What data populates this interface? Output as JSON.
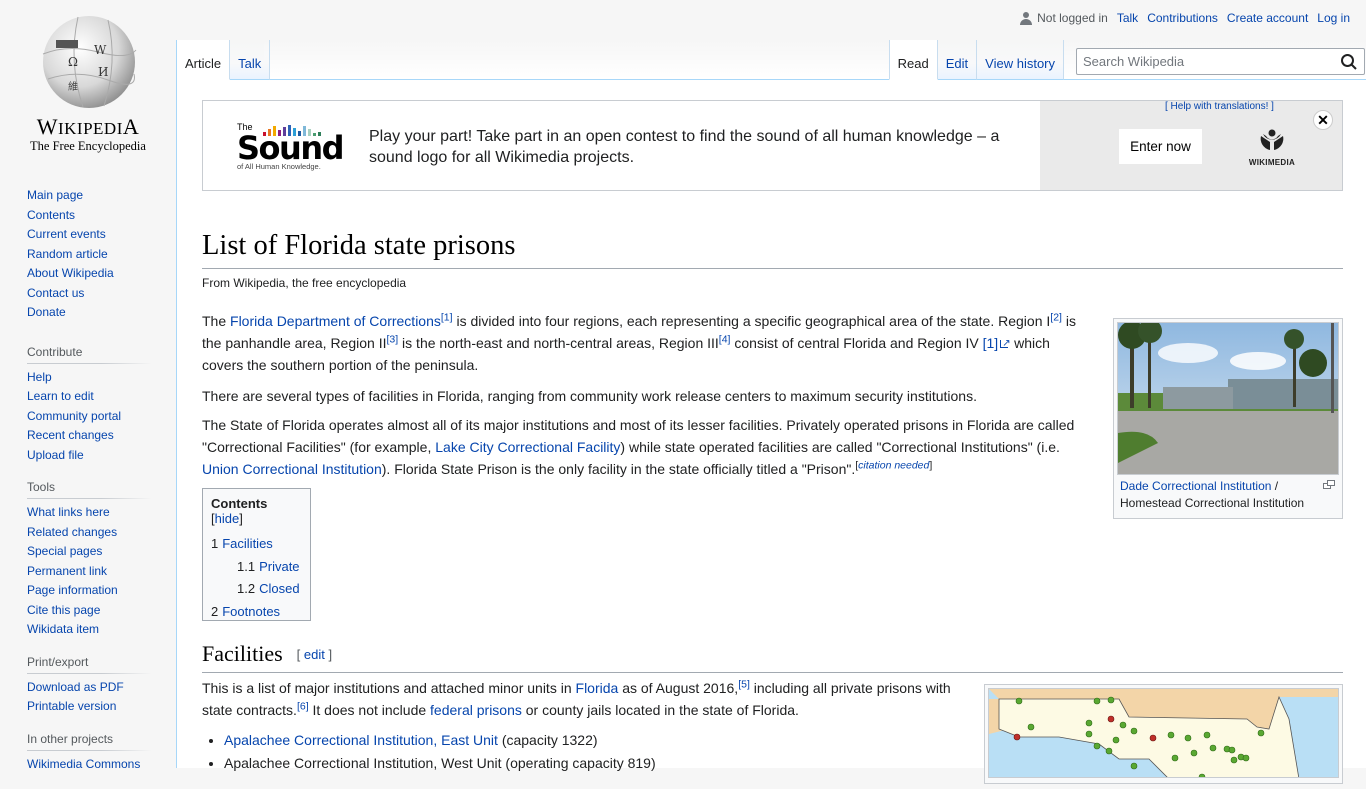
{
  "logo": {
    "wordmark_first": "W",
    "wordmark_rest": "IKIPEDI",
    "wordmark_last": "A",
    "tagline": "The Free Encyclopedia"
  },
  "personal": {
    "anon": "Not logged in",
    "links": [
      "Talk",
      "Contributions",
      "Create account",
      "Log in"
    ]
  },
  "tabs": {
    "left": [
      {
        "label": "Article",
        "selected": true
      },
      {
        "label": "Talk",
        "selected": false
      }
    ],
    "right": [
      {
        "label": "Read",
        "selected": true
      },
      {
        "label": "Edit",
        "selected": false
      },
      {
        "label": "View history",
        "selected": false
      }
    ]
  },
  "search": {
    "placeholder": "Search Wikipedia",
    "value": ""
  },
  "sidebar": {
    "navigation": [
      "Main page",
      "Contents",
      "Current events",
      "Random article",
      "About Wikipedia",
      "Contact us",
      "Donate"
    ],
    "contribute": {
      "title": "Contribute",
      "items": [
        "Help",
        "Learn to edit",
        "Community portal",
        "Recent changes",
        "Upload file"
      ]
    },
    "tools": {
      "title": "Tools",
      "items": [
        "What links here",
        "Related changes",
        "Special pages",
        "Permanent link",
        "Page information",
        "Cite this page",
        "Wikidata item"
      ]
    },
    "print": {
      "title": "Print/export",
      "items": [
        "Download as PDF",
        "Printable version"
      ]
    },
    "other": {
      "title": "In other projects",
      "items": [
        "Wikimedia Commons"
      ]
    }
  },
  "banner": {
    "logo_the": "The",
    "logo_sound": "Sound",
    "logo_sub": "of All Human Knowledge.",
    "message": "Play your part! Take part in an open contest to find the sound of all human knowledge – a sound logo for all Wikimedia projects.",
    "help": "[ Help with translations! ]",
    "button": "Enter now",
    "wikimedia": "WIKIMEDIA",
    "close": "✕",
    "bar_colors": [
      "#c8102e",
      "#e87722",
      "#f2a900",
      "#8c1d82",
      "#5e3f9b",
      "#2d63b6",
      "#2d9fd6",
      "#1e5a9f",
      "#7fb8d8",
      "#a8d0c0",
      "#4a9b6f",
      "#2f7f5a"
    ]
  },
  "article": {
    "title": "List of Florida state prisons",
    "tagline": "From Wikipedia, the free encyclopedia",
    "p1": {
      "t1": "The ",
      "l1": "Florida Department of Corrections",
      "r1": "[1]",
      "t2": " is divided into four regions, each representing a specific geographical area of the state. Region I",
      "r2": "[2]",
      "t3": " is the panhandle area, Region II",
      "r3": "[3]",
      "t4": " is the north-east and north-central areas, Region III",
      "r4": "[4]",
      "t5": " consist of central Florida and Region IV ",
      "ext": "[1]",
      "t6": " which covers the southern portion of the peninsula."
    },
    "p2": "There are several types of facilities in Florida, ranging from community work release centers to maximum security institutions.",
    "p3": {
      "t1": "The State of Florida operates almost all of its major institutions and most of its lesser facilities. Privately operated prisons in Florida are called \"Correctional Facilities\" (for example, ",
      "l1": "Lake City Correctional Facility",
      "t2": ") while state operated facilities are called \"Correctional Institutions\" (i.e. ",
      "l2": "Union Correctional Institution",
      "t3": "). Florida State Prison is the only facility in the state officially titled a \"Prison\".",
      "cn_open": "[",
      "cn": "citation needed",
      "cn_close": "]"
    },
    "thumb": {
      "caption_link": "Dade Correctional Institution",
      "caption_sep": " / ",
      "caption_text": "Homestead Correctional Institution"
    },
    "toc": {
      "title": "Contents",
      "toggle_open": " [",
      "toggle": "hide",
      "toggle_close": "]",
      "items": [
        {
          "num": "1",
          "label": "Facilities",
          "level": 1
        },
        {
          "num": "1.1",
          "label": "Private",
          "level": 2
        },
        {
          "num": "1.2",
          "label": "Closed",
          "level": 2
        },
        {
          "num": "2",
          "label": "Footnotes",
          "level": 1
        }
      ]
    },
    "section": {
      "title": "Facilities",
      "edit_open": "[ ",
      "edit": "edit",
      "edit_close": " ]"
    },
    "p4": {
      "t1": "This is a list of major institutions and attached minor units in ",
      "l1": "Florida",
      "t2": " as of August 2016,",
      "r1": "[5]",
      "t3": " including all private prisons with state contracts.",
      "r2": "[6]",
      "t4": " It does not include ",
      "l2": "federal prisons",
      "t5": " or county jails located in the state of Florida."
    },
    "list": [
      {
        "link": "Apalachee Correctional Institution, East Unit",
        "text": " (capacity 1322)"
      },
      {
        "link": "",
        "text": "Apalachee Correctional Institution, West Unit (operating capacity 819)"
      }
    ]
  }
}
